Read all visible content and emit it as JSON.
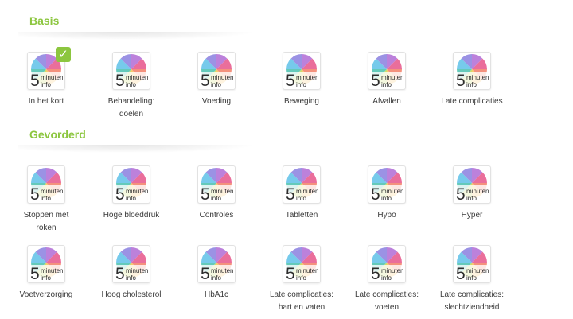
{
  "brand_color": "#8cc63f",
  "logo": {
    "digit": "5",
    "word_top": "minuten",
    "word_bottom": "info"
  },
  "sections": [
    {
      "title": "Basis",
      "modules": [
        {
          "label": "In het kort",
          "completed": true
        },
        {
          "label": "Behandeling:\ndoelen"
        },
        {
          "label": "Voeding"
        },
        {
          "label": "Beweging"
        },
        {
          "label": "Afvallen"
        },
        {
          "label": "Late complicaties"
        }
      ]
    },
    {
      "title": "Gevorderd",
      "modules": [
        {
          "label": "Stoppen met\nroken"
        },
        {
          "label": "Hoge bloeddruk"
        },
        {
          "label": "Controles"
        },
        {
          "label": "Tabletten"
        },
        {
          "label": "Hypo"
        },
        {
          "label": "Hyper"
        },
        {
          "label": "Voetverzorging"
        },
        {
          "label": "Hoog cholesterol"
        },
        {
          "label": "HbA1c"
        },
        {
          "label": "Late complicaties:\nhart en vaten"
        },
        {
          "label": "Late complicaties:\nvoeten"
        },
        {
          "label": "Late complicaties:\nslechtziendheid"
        }
      ]
    }
  ]
}
